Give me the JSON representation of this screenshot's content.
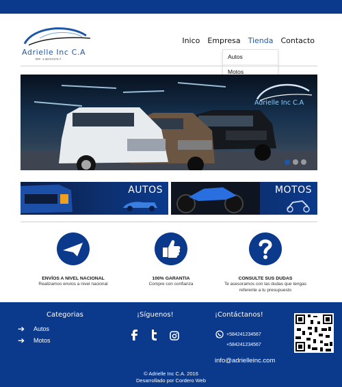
{
  "brand": {
    "name": "Adrielle Inc C.A",
    "rif": "RIF: J-40747274-7"
  },
  "nav": {
    "items": [
      "Inico",
      "Empresa",
      "Tienda",
      "Contacto"
    ],
    "active": "Tienda",
    "dropdown": [
      "Autos",
      "Motos"
    ]
  },
  "slider": {
    "watermark": "Adrielle Inc C.A",
    "dots": 3,
    "active_dot": 1
  },
  "banners": [
    {
      "label": "AUTOS"
    },
    {
      "label": "MOTOS"
    }
  ],
  "features": [
    {
      "icon": "paper-plane-icon",
      "title": "ENVÍOS A NIVEL NACIONAL",
      "desc": "Realizamos envios a nivel nacional"
    },
    {
      "icon": "thumbs-up-icon",
      "title": "100% GARANTIA",
      "desc": "Compre con confianza"
    },
    {
      "icon": "question-icon",
      "title": "CONSULTE SUS DUDAS",
      "desc": "Te asesoramos con las dudas que tengas referente a tu presupuesto"
    }
  ],
  "footer": {
    "categories_title": "Categorias",
    "categories": [
      "Autos",
      "Motos"
    ],
    "social_title": "¡Síguenos!",
    "social": [
      "facebook-icon",
      "twitter-icon",
      "instagram-icon"
    ],
    "contact_title": "¡Contáctanos!",
    "phones": [
      "+584241234567",
      "+584241234567"
    ],
    "email": "info@adrielleinc.com",
    "copyright": "© Adrielle Inc C.A. 2016",
    "credit": "Desarrollado por Cordero Web"
  },
  "colors": {
    "primary": "#0b3a8c",
    "accent": "#1e57a8"
  }
}
